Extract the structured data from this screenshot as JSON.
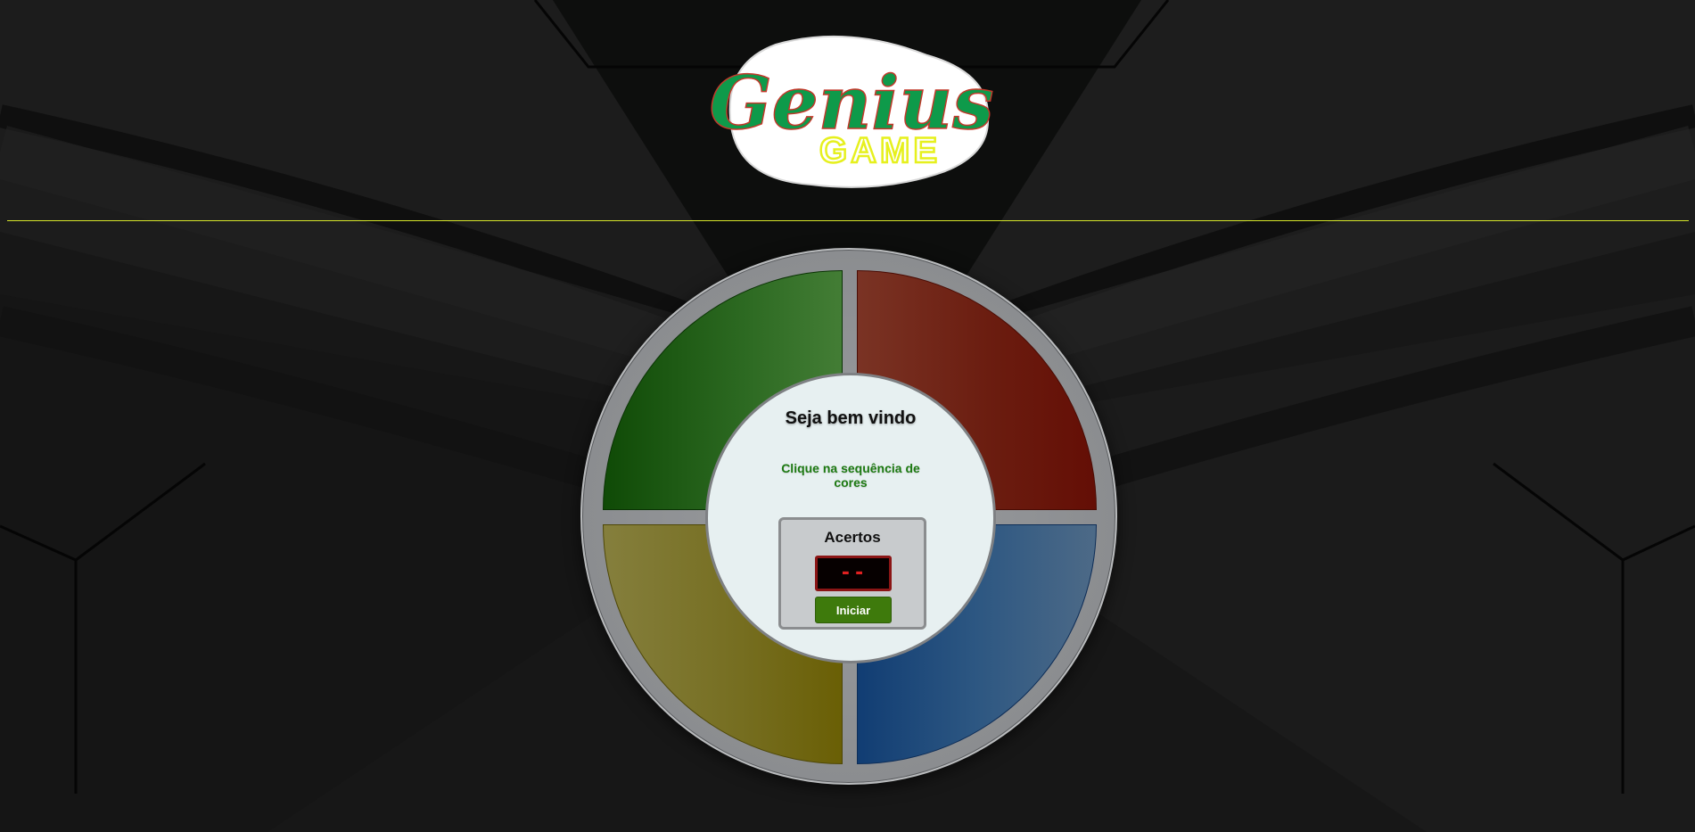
{
  "logo": {
    "word": "Genius",
    "sub": "GAME"
  },
  "game": {
    "pads": [
      {
        "color": "green",
        "hex": "#2d6a22"
      },
      {
        "color": "red",
        "hex": "#6b1d10"
      },
      {
        "color": "yellow",
        "hex": "#756d1f"
      },
      {
        "color": "blue",
        "hex": "#2d5782"
      }
    ],
    "welcome": "Seja bem vindo",
    "instruction": "Clique na sequência de cores",
    "score_label": "Acertos",
    "score_value": "--",
    "start_label": "Iniciar"
  },
  "colors": {
    "divider": "#d6e62a",
    "logo_green": "#0e9a4a",
    "logo_yellow": "#e6f01e",
    "score_digits": "#e02020"
  }
}
